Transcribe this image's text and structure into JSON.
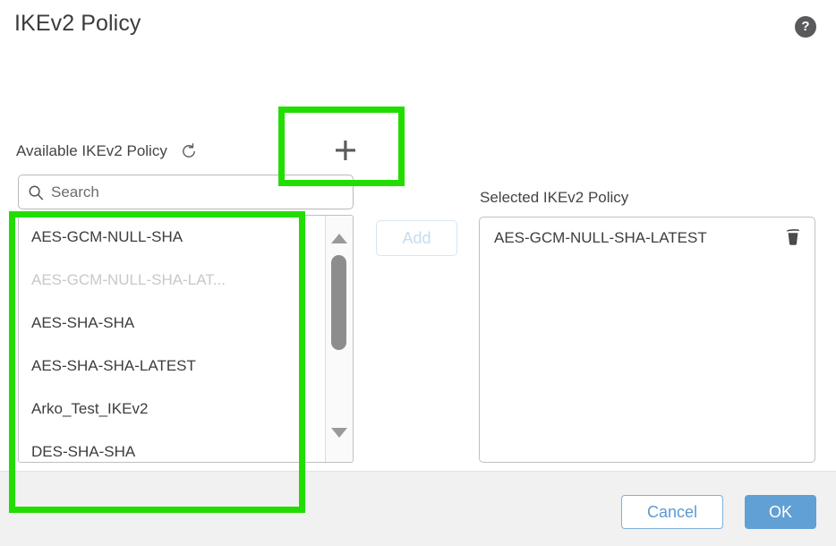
{
  "header": {
    "title": "IKEv2 Policy",
    "help_icon": "help-circle-icon",
    "help_glyph": "?"
  },
  "available": {
    "label": "Available IKEv2 Policy",
    "refresh_icon": "refresh-icon",
    "add_new_icon": "plus-icon",
    "search": {
      "placeholder": "Search",
      "value": "",
      "icon": "search-icon"
    },
    "items": [
      {
        "label": "AES-GCM-NULL-SHA",
        "disabled": false
      },
      {
        "label": "AES-GCM-NULL-SHA-LAT...",
        "disabled": true
      },
      {
        "label": "AES-SHA-SHA",
        "disabled": false
      },
      {
        "label": "AES-SHA-SHA-LATEST",
        "disabled": false
      },
      {
        "label": "Arko_Test_IKEv2",
        "disabled": false
      },
      {
        "label": "DES-SHA-SHA",
        "disabled": false
      }
    ],
    "scrollbar": {
      "up_arrow_icon": "caret-up-icon",
      "down_arrow_icon": "caret-down-icon",
      "thumb": "scrollbar-thumb"
    }
  },
  "add_button": {
    "label": "Add",
    "disabled": true
  },
  "selected": {
    "label": "Selected IKEv2 Policy",
    "items": [
      {
        "label": "AES-GCM-NULL-SHA-LATEST",
        "delete_icon": "trash-icon"
      }
    ]
  },
  "footer": {
    "cancel_label": "Cancel",
    "ok_label": "OK"
  },
  "annotations": {
    "color": "#22dd00",
    "boxes": [
      {
        "name": "highlight-add-new-policy-button"
      },
      {
        "name": "highlight-available-policy-list"
      }
    ]
  },
  "colors": {
    "accent_blue": "#61a0d4",
    "cancel_blue": "#5b9bd5",
    "highlight_green": "#22dd00",
    "footer_bg": "#f1f1f1",
    "header_sep": "#e4e4e4",
    "text": "#3d3d3d",
    "disabled_text": "#c8c8c8"
  }
}
